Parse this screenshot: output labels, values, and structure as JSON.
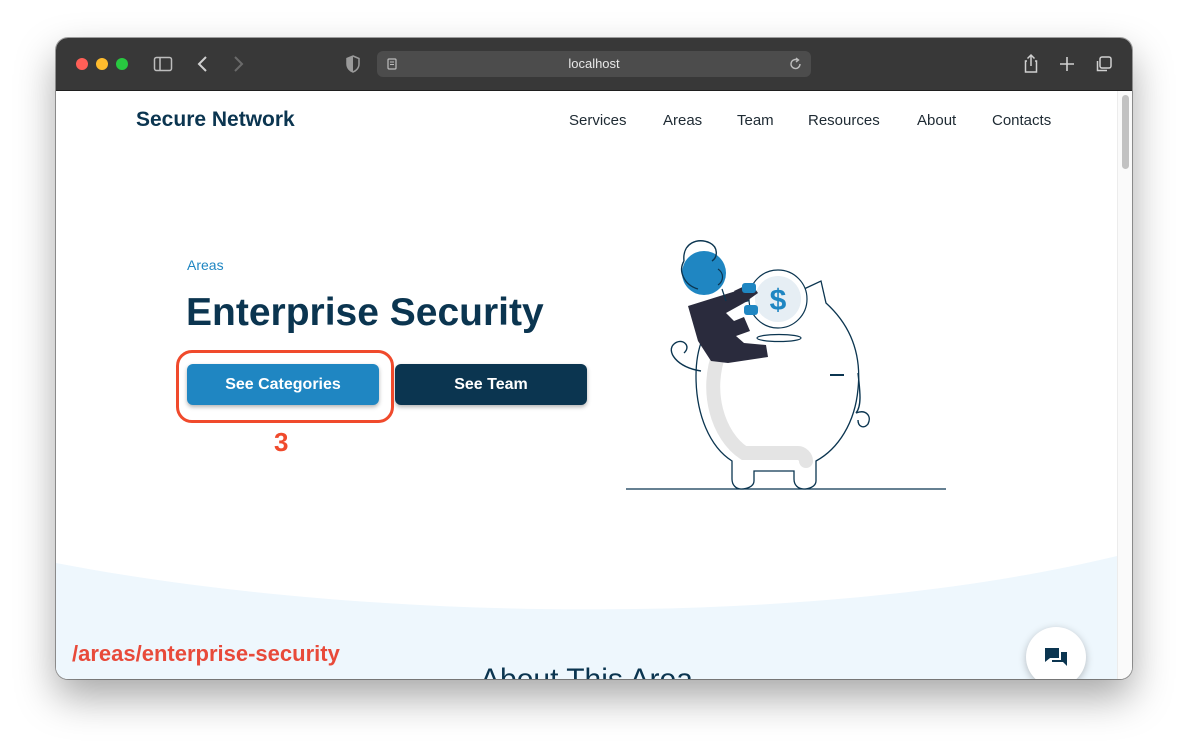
{
  "browser": {
    "url": "localhost"
  },
  "header": {
    "brand": "Secure Network",
    "nav": [
      "Services",
      "Areas",
      "Team",
      "Resources",
      "About",
      "Contacts"
    ]
  },
  "hero": {
    "eyebrow": "Areas",
    "title": "Enterprise Security",
    "primary_button": "See Categories",
    "secondary_button": "See Team"
  },
  "annotation": {
    "step_number": "3",
    "route": "/areas/enterprise-security"
  },
  "section": {
    "heading": "About This Area"
  },
  "illustration": {
    "coin_symbol": "$"
  },
  "colors": {
    "brand_dark": "#0b3550",
    "primary_blue": "#1f86c2",
    "annotation_red": "#f04a2c",
    "wave_fill": "#eef7fd"
  },
  "icons": [
    "sidebar-icon",
    "back-icon",
    "forward-icon",
    "shield-icon",
    "page-icon",
    "reload-icon",
    "share-icon",
    "new-tab-icon",
    "tabs-icon",
    "chat-icon"
  ]
}
